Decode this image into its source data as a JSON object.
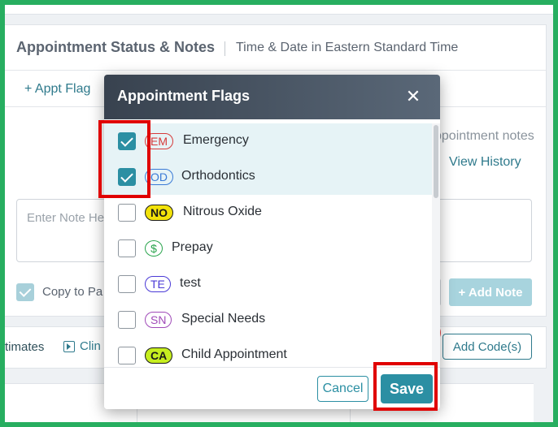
{
  "background_panel": {
    "title": "Appointment Status & Notes",
    "subtitle": "Time & Date in Eastern Standard Time",
    "appt_flag_link": "+ Appt Flag",
    "notes_hint": "ppointment notes",
    "view_history": "View History",
    "note_placeholder": "Enter Note He",
    "copy_label": "Copy to Pa",
    "add_note": "+ Add Note",
    "estimates_label": "timates",
    "clin_link": "Clin",
    "add_code": "Add Code(s)"
  },
  "modal": {
    "title": "Appointment Flags",
    "close_glyph": "✕",
    "flags": [
      {
        "code": "EM",
        "label": "Emergency",
        "checked": true,
        "color": "#d63a3a"
      },
      {
        "code": "OD",
        "label": "Orthodontics",
        "checked": true,
        "color": "#3a7ad6"
      },
      {
        "code": "NO",
        "label": "Nitrous Oxide",
        "checked": false,
        "color": "#1a1a1a",
        "fill": "#f2e20a"
      },
      {
        "code": "$",
        "label": "Prepay",
        "checked": false,
        "color": "#27a34b"
      },
      {
        "code": "TE",
        "label": "test",
        "checked": false,
        "color": "#4a3ad6"
      },
      {
        "code": "SN",
        "label": "Special Needs",
        "checked": false,
        "color": "#a04ab8"
      },
      {
        "code": "CA",
        "label": "Child Appointment",
        "checked": false,
        "color": "#1a1a1a",
        "fill": "#c6ee1f"
      }
    ],
    "cancel_label": "Cancel",
    "save_label": "Save"
  },
  "colors": {
    "accent": "#2b8fa3",
    "header_dark": "#38424f",
    "highlight": "#e00000",
    "outer_border": "#27ae60"
  }
}
